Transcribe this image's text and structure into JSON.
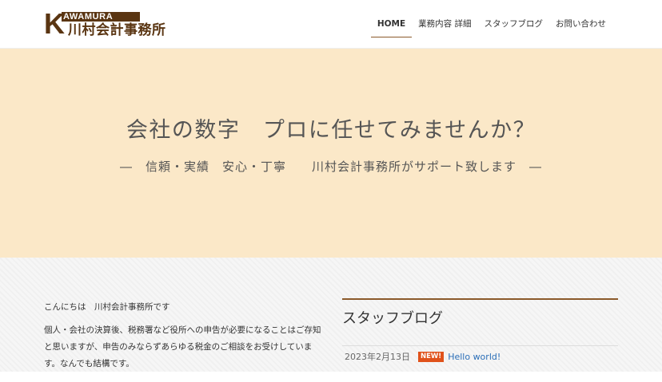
{
  "logo": {
    "letter": "K",
    "en": "AWAMURA",
    "jp": "川村会計事務所"
  },
  "nav": {
    "items": [
      {
        "label": "HOME"
      },
      {
        "label": "業務内容 詳細"
      },
      {
        "label": "スタッフブログ"
      },
      {
        "label": "お問い合わせ"
      }
    ]
  },
  "hero": {
    "title": "会社の数字　プロに任せてみませんか？",
    "subtitle": "―　信頼・実績　安心・丁寧　　川村会計事務所がサポート致します　―"
  },
  "intro": {
    "greeting": "こんにちは　川村会計事務所です",
    "body": "個人・会社の決算後、税務署など役所への申告が必要になることはご存知と思いますが、申告のみならずあらゆる税金のご相談をお受けしています。なんでも結構です。"
  },
  "blog": {
    "title": "スタッフブログ",
    "posts": [
      {
        "date": "2023年2月13日",
        "badge": "NEW!",
        "title": "Hello world!"
      }
    ]
  },
  "colors": {
    "brand": "#5a3512",
    "hero_bg": "#fbe8c8",
    "accent_line": "#8b5a2b",
    "badge": "#e0521b",
    "link": "#2b6fb8"
  }
}
